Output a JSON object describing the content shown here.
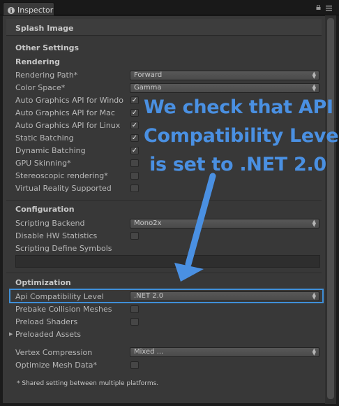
{
  "tab": {
    "label": "Inspector"
  },
  "sections": {
    "splash": "Splash Image",
    "other": "Other Settings"
  },
  "rendering": {
    "title": "Rendering",
    "rendering_path": {
      "label": "Rendering Path*",
      "value": "Forward"
    },
    "color_space": {
      "label": "Color Space*",
      "value": "Gamma"
    },
    "auto_api_windows": {
      "label": "Auto Graphics API for Windo",
      "checked": true
    },
    "auto_api_mac": {
      "label": "Auto Graphics API for Mac",
      "checked": true
    },
    "auto_api_linux": {
      "label": "Auto Graphics API for Linux",
      "checked": true
    },
    "static_batching": {
      "label": "Static Batching",
      "checked": true
    },
    "dynamic_batching": {
      "label": "Dynamic Batching",
      "checked": true
    },
    "gpu_skinning": {
      "label": "GPU Skinning*",
      "checked": false
    },
    "stereoscopic": {
      "label": "Stereoscopic rendering*",
      "checked": false
    },
    "vr_supported": {
      "label": "Virtual Reality Supported",
      "checked": false
    }
  },
  "configuration": {
    "title": "Configuration",
    "scripting_backend": {
      "label": "Scripting Backend",
      "value": "Mono2x"
    },
    "disable_hw_stats": {
      "label": "Disable HW Statistics",
      "checked": false
    },
    "define_symbols": {
      "label": "Scripting Define Symbols",
      "value": ""
    }
  },
  "optimization": {
    "title": "Optimization",
    "api_compat": {
      "label": "Api Compatibility Level",
      "value": ".NET 2.0"
    },
    "prebake": {
      "label": "Prebake Collision Meshes",
      "checked": false
    },
    "preload_shaders": {
      "label": "Preload Shaders",
      "checked": false
    },
    "preloaded_assets": {
      "label": "Preloaded Assets"
    },
    "vertex_compression": {
      "label": "Vertex Compression",
      "value": "Mixed ..."
    },
    "optimize_mesh": {
      "label": "Optimize Mesh Data*",
      "checked": false
    }
  },
  "footnote": "* Shared setting between multiple platforms.",
  "annotation": {
    "line1": "We check that API",
    "line2": "Compatibility Level",
    "line3": "is set to .NET 2.0"
  },
  "colors": {
    "accent": "#4a90e2",
    "panel": "#383838",
    "highlight_border": "#3f8fd8"
  }
}
